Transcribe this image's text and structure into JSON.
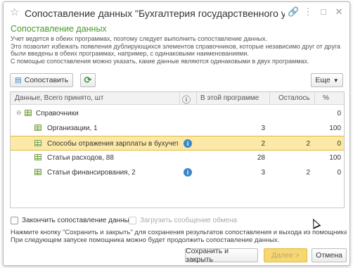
{
  "window": {
    "title": "Сопоставление данных \"Бухгалтерия государственного у...",
    "icons": [
      "star-icon",
      "link-icon",
      "more-icon",
      "maximize-icon",
      "close-icon"
    ]
  },
  "subtitle": "Сопоставление данных",
  "description": [
    "Учет ведется в обеих программах, поэтому следует выполнить сопоставление данных.",
    "Это позволит избежать появления дублирующихся элементов справочников, которые независимо друг от друга",
    "были введены в обеих программах, например, с одинаковыми наименованиями.",
    "С помощью сопоставления можно указать, какие данные являются одинаковыми в двух программах."
  ],
  "toolbar": {
    "match_label": "Сопоставить",
    "more_label": "Еще"
  },
  "grid": {
    "headers": {
      "name": "Данные, Всего принято, шт",
      "info": "ⓘ",
      "in_program": "В этой программе",
      "remaining": "Осталось",
      "percent": "%"
    },
    "rows": [
      {
        "name": "Справочники",
        "in_program": "",
        "remaining": "",
        "percent": "0"
      },
      {
        "name": "Организации, 1",
        "in_program": "3",
        "remaining": "",
        "percent": "100"
      },
      {
        "name": "Способы отражения зарплаты в бухучет...",
        "in_program": "2",
        "remaining": "2",
        "percent": "0"
      },
      {
        "name": "Статьи расходов, 88",
        "in_program": "28",
        "remaining": "",
        "percent": "100"
      },
      {
        "name": "Статьи финансирования, 2",
        "in_program": "3",
        "remaining": "2",
        "percent": "0"
      }
    ]
  },
  "checkboxes": {
    "finish_label": "Закончить сопоставление данных",
    "load_label": "Загрузить сообщение обмена"
  },
  "note": [
    "Нажмите кнопку \"Сохранить и закрыть\" для сохранения результатов сопоставления и выхода из помощника.",
    "При следующем запуске помощника можно будет продолжить сопоставление данных."
  ],
  "buttons": {
    "save_close": "Сохранить и закрыть",
    "next": "Далее >",
    "cancel": "Отмена"
  },
  "colors": {
    "accent_green": "#4a9a2a",
    "selection": "#fce9a8",
    "info_blue": "#3a86c8"
  }
}
